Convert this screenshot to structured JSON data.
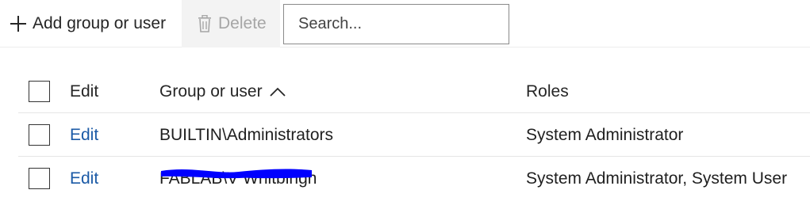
{
  "toolbar": {
    "add_label": "Add group or user",
    "delete_label": "Delete",
    "search_placeholder": "Search..."
  },
  "table": {
    "headers": {
      "edit": "Edit",
      "group": "Group or user",
      "roles": "Roles"
    },
    "rows": [
      {
        "edit": "Edit",
        "group": "BUILTIN\\Administrators",
        "roles": "System Administrator"
      },
      {
        "edit": "Edit",
        "group": "FABLAB\\V Whitbingh",
        "roles": "System Administrator, System User"
      }
    ]
  },
  "colors": {
    "link": "#1b5aa6",
    "redaction": "#0000ff",
    "delete_bg": "#f3f3f3",
    "disabled_text": "#a6a6a6"
  },
  "icons": {
    "add": "plus-icon",
    "delete": "trash-icon",
    "sort": "chevron-up-icon"
  }
}
